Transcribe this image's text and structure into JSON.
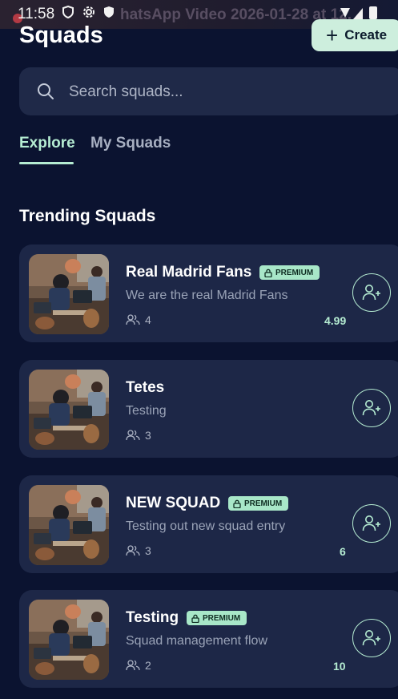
{
  "status_bar": {
    "time": "11:58",
    "overlay_text": "hatsApp Video 2026-01-28 at 12."
  },
  "header": {
    "title": "Squads",
    "create_label": "Create"
  },
  "search": {
    "placeholder": "Search squads..."
  },
  "tabs": [
    {
      "label": "Explore",
      "active": true
    },
    {
      "label": "My Squads",
      "active": false
    }
  ],
  "section_title": "Trending Squads",
  "squads": [
    {
      "name": "Real Madrid Fans",
      "premium": true,
      "badge_label": "PREMIUM",
      "description": "We are the real Madrid Fans",
      "members": "4",
      "price": "4.99"
    },
    {
      "name": "Tetes",
      "premium": false,
      "description": "Testing",
      "members": "3",
      "price": ""
    },
    {
      "name": "NEW SQUAD",
      "premium": true,
      "badge_label": "PREMIUM",
      "description": "Testing out new squad entry",
      "members": "3",
      "price": "6"
    },
    {
      "name": "Testing",
      "premium": true,
      "badge_label": "PREMIUM",
      "description": "Squad management flow",
      "members": "2",
      "price": "10"
    }
  ],
  "colors": {
    "background": "#0b1330",
    "card": "#1d2747",
    "accent": "#b5ecd2",
    "create_button": "#cdeedd"
  },
  "icons": {
    "search": "search-icon",
    "members": "people-icon",
    "join": "add-user-icon",
    "premium": "lock-icon",
    "create": "plus-icon"
  }
}
